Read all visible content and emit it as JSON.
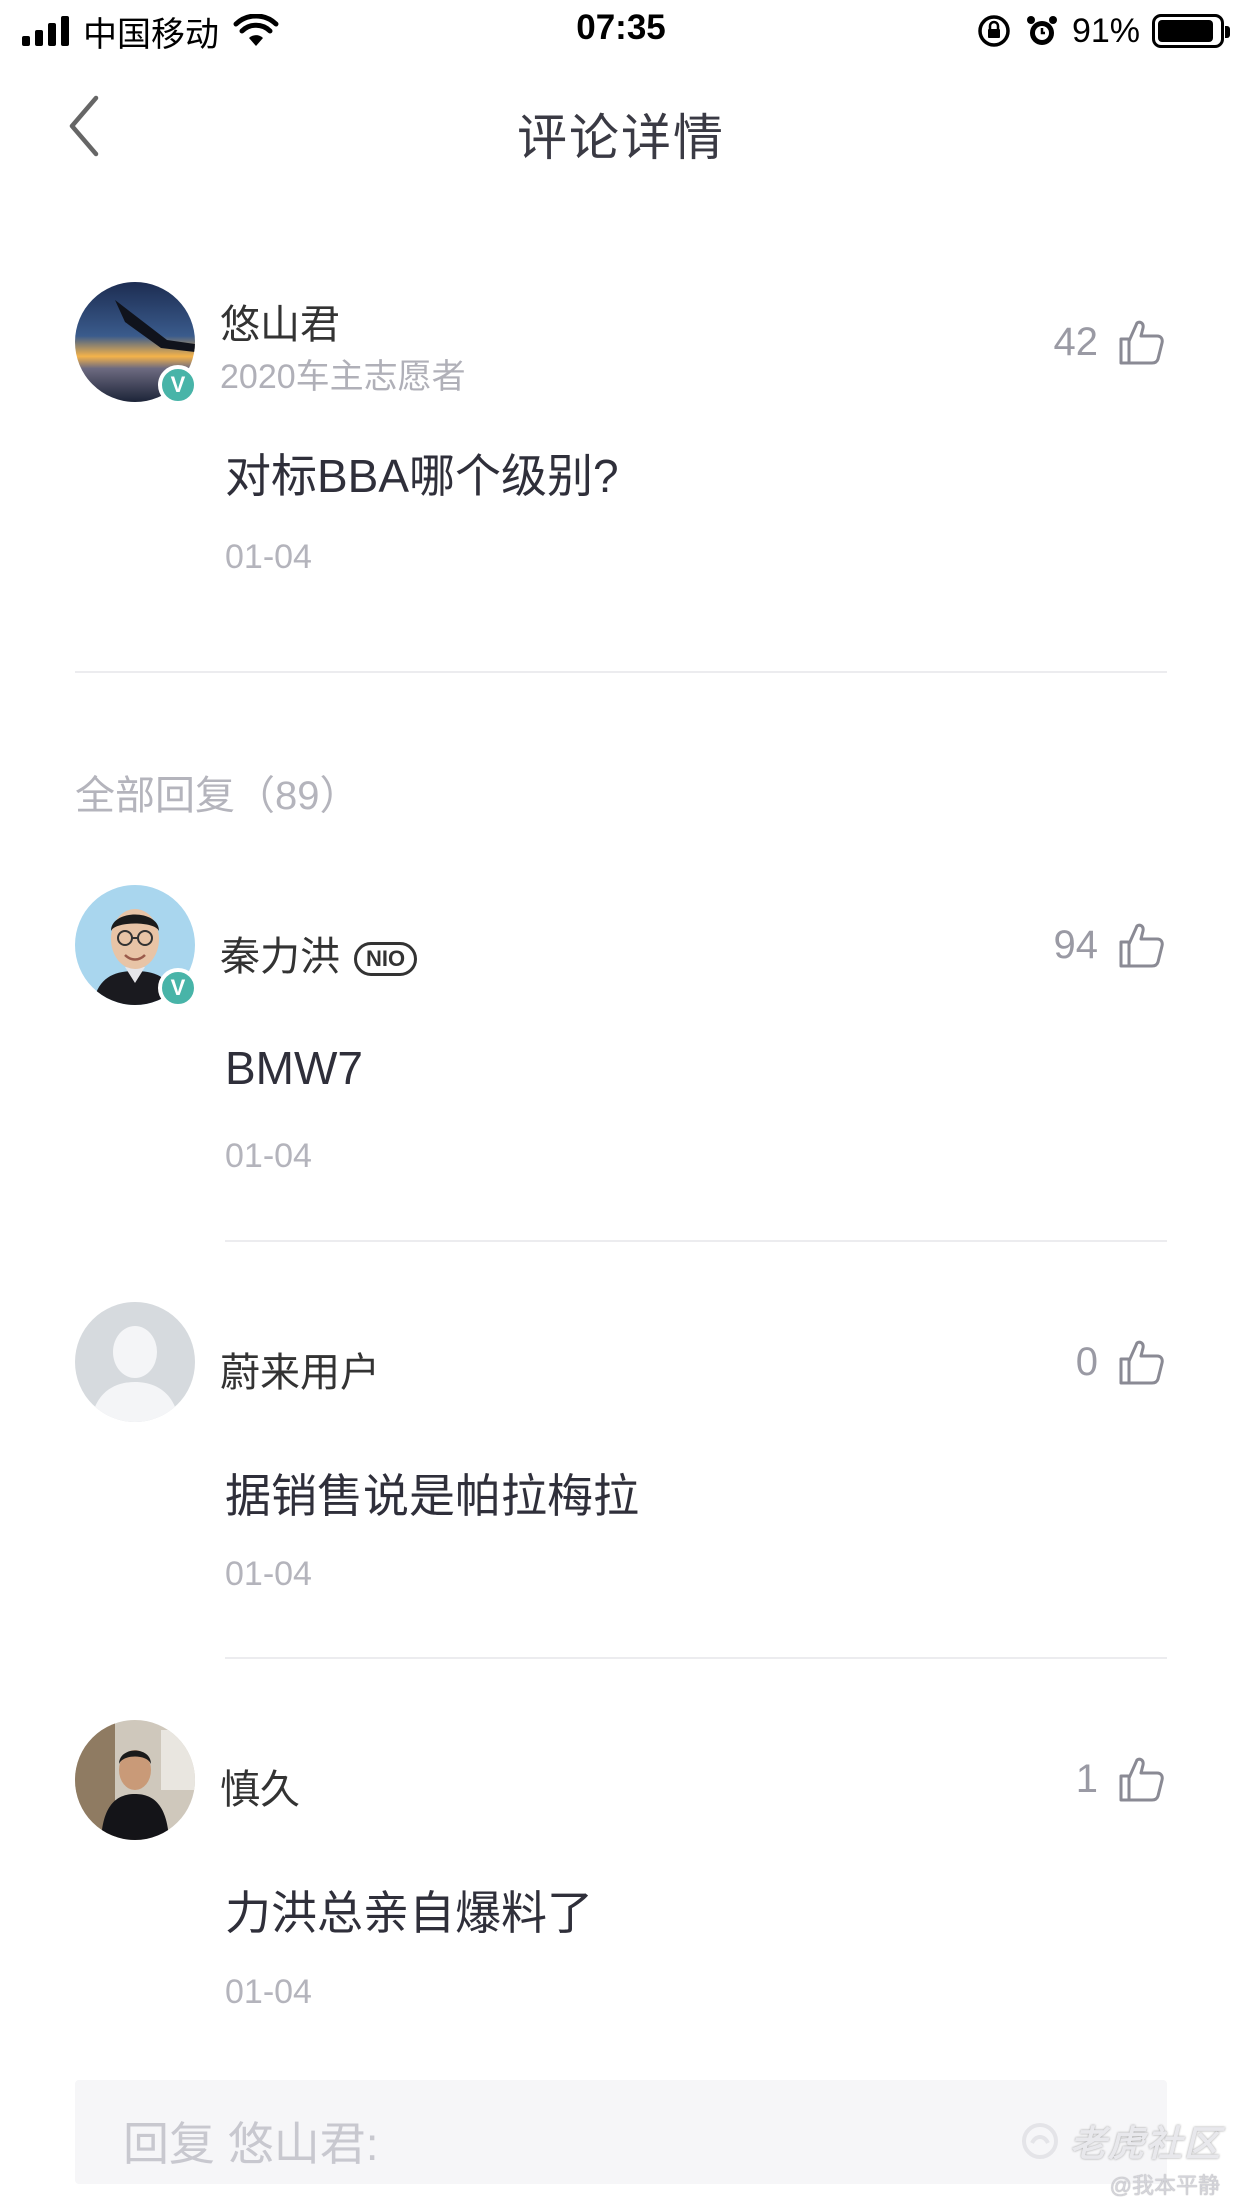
{
  "status_bar": {
    "carrier": "中国移动",
    "time": "07:35",
    "battery_percent": "91%",
    "battery_level": 0.91
  },
  "nav": {
    "title": "评论详情",
    "back_icon": "chevron-left-icon"
  },
  "main_comment": {
    "username": "悠山君",
    "user_tag": "2020车主志愿者",
    "verified": true,
    "likes": "42",
    "text": "对标BBA哪个级别?",
    "date": "01-04"
  },
  "replies_header": "全部回复（89）",
  "replies": [
    {
      "username": "秦力洪",
      "badge": "NIO",
      "verified": true,
      "likes": "94",
      "text": "BMW7",
      "date": "01-04"
    },
    {
      "username": "蔚来用户",
      "verified": false,
      "likes": "0",
      "text": "据销售说是帕拉梅拉",
      "date": "01-04"
    },
    {
      "username": "慎久",
      "verified": false,
      "likes": "1",
      "text": "力洪总亲自爆料了",
      "date": "01-04"
    }
  ],
  "reply_input": {
    "placeholder": "回复 悠山君:"
  },
  "watermark": {
    "logo_text": "老虎社区",
    "handle": "@我本平静"
  },
  "colors": {
    "verified_badge": "#48b4a8",
    "muted_text": "#b4b4bc",
    "divider": "#ececef",
    "input_bg": "#f6f6f8"
  }
}
